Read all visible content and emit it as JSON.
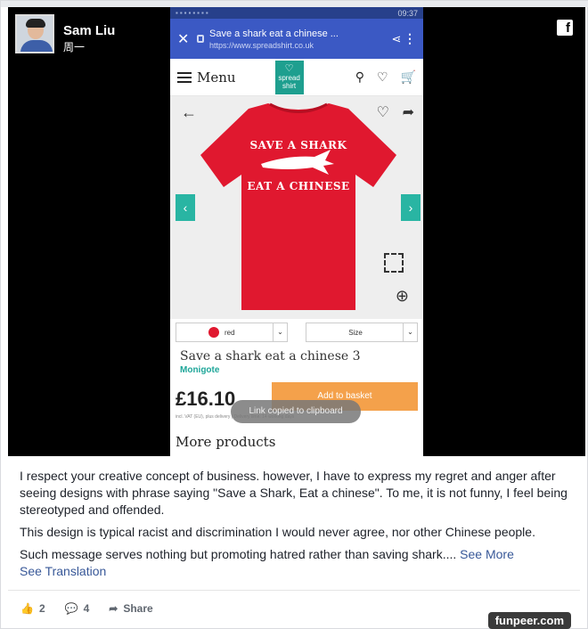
{
  "poster": {
    "name": "Sam Liu",
    "sub": "周一"
  },
  "facebook_icon": "facebook-icon",
  "phone": {
    "status_time": "09:37",
    "url_title": "Save a shark eat a chinese ...",
    "url_domain": "https://www.spreadshirt.co.uk",
    "menu_label": "Menu",
    "brand_line1": "spread",
    "brand_line2": "shirt",
    "tee_line1": "SAVE A SHARK",
    "tee_line2": "EAT A CHINESE",
    "color_select": "red",
    "size_select": "Size",
    "product_title": "Save a shark eat a chinese 3",
    "product_brand": "Monigote",
    "price": "£16.10",
    "basket_label": "Add to basket",
    "fine_print": "incl. VAT (EU), plus delivery | Delivery time: 14 working days",
    "toast": "Link copied to clipboard",
    "more_products": "More products"
  },
  "post": {
    "p1": "I respect your creative concept of business. however, I have to express my regret and anger after seeing designs with phrase saying \"Save a Shark, Eat a chinese\". To me, it is not funny, I feel being stereotyped and offended.",
    "p2": "This design is typical racist and discrimination I would never agree, nor other Chinese people.",
    "p3": "Such message serves nothing but promoting hatred rather than saving shark....",
    "see_more": "See More",
    "see_translation": "See Translation"
  },
  "actions": {
    "likes": "2",
    "comments": "4",
    "share": "Share"
  },
  "watermark": "funpeer.com",
  "colors": {
    "tee_red": "#e0182f",
    "teal": "#29b5a3",
    "basket": "#f4a14b",
    "link": "#385898"
  }
}
